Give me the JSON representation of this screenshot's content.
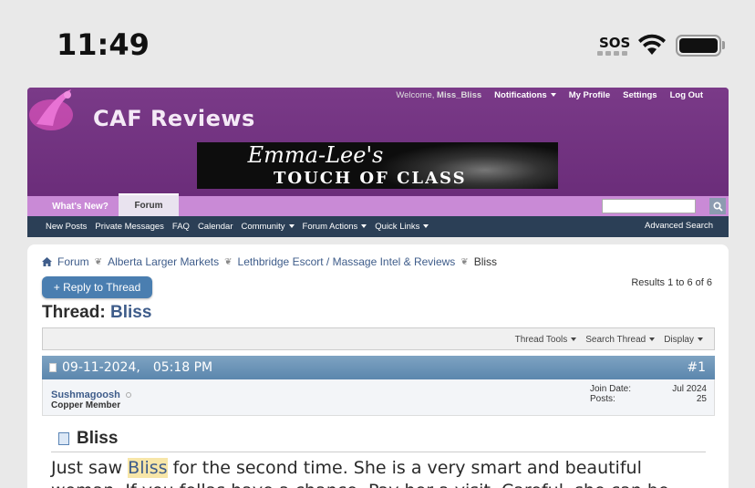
{
  "status": {
    "time": "11:49",
    "sos": "SOS"
  },
  "site": {
    "name": "CAF Reviews"
  },
  "toplinks": {
    "welcome": "Welcome,",
    "user": "Miss_Bliss",
    "notifications": "Notifications",
    "profile": "My Profile",
    "settings": "Settings",
    "logout": "Log Out"
  },
  "banner": {
    "script": "Emma-Lee's",
    "caps": "TOUCH OF CLASS"
  },
  "tabs": {
    "whats_new": "What's New?",
    "forum": "Forum"
  },
  "navbar": {
    "items": [
      "New Posts",
      "Private Messages",
      "FAQ",
      "Calendar",
      "Community",
      "Forum Actions",
      "Quick Links"
    ],
    "advanced": "Advanced Search"
  },
  "breadcrumb": [
    "Forum",
    "Alberta Larger Markets",
    "Lethbridge Escort / Massage Intel & Reviews",
    "Bliss"
  ],
  "reply_button": "+ Reply to Thread",
  "results": "Results 1 to 6 of 6",
  "thread": {
    "label": "Thread:",
    "name": "Bliss"
  },
  "tools": [
    "Thread Tools",
    "Search Thread",
    "Display"
  ],
  "post": {
    "date": "09-11-2024,",
    "time": "05:18 PM",
    "number": "#1",
    "username": "Sushmagoosh",
    "usertitle": "Copper Member",
    "join_label": "Join Date:",
    "join_value": "Jul 2024",
    "posts_label": "Posts:",
    "posts_value": "25",
    "title": "Bliss",
    "body_pre": "Just saw ",
    "body_hl": "Bliss",
    "body_post": " for the second time. She is a very smart and beautiful woman. If you fellas have a chance. Pay her a visit. Careful, she can be"
  }
}
